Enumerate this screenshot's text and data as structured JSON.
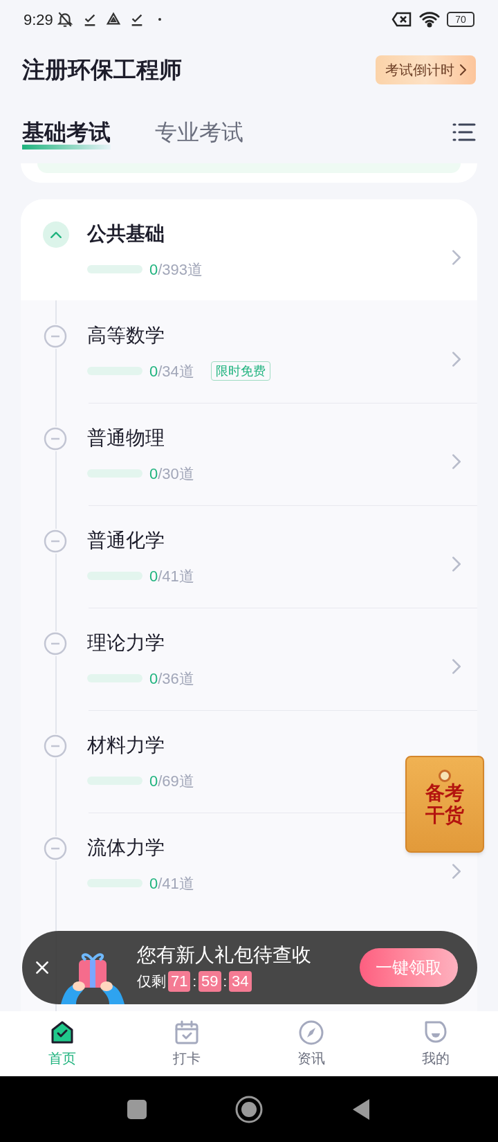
{
  "status_bar": {
    "time": "9:29",
    "battery": "70"
  },
  "header": {
    "title": "注册环保工程师",
    "countdown_button": "考试倒计时"
  },
  "tabs": [
    {
      "label": "基础考试",
      "selected": true
    },
    {
      "label": "专业考试",
      "selected": false
    }
  ],
  "section": {
    "title": "公共基础",
    "done": "0",
    "total": "/393道",
    "expanded": true,
    "level": 0
  },
  "subjects": [
    {
      "title": "高等数学",
      "done": "0",
      "total": "/34道",
      "tag": "限时免费",
      "level": 0
    },
    {
      "title": "普通物理",
      "done": "0",
      "total": "/30道",
      "level": 0
    },
    {
      "title": "普通化学",
      "done": "0",
      "total": "/41道",
      "level": 0
    },
    {
      "title": "理论力学",
      "done": "0",
      "total": "/36道",
      "level": 0
    },
    {
      "title": "材料力学",
      "done": "0",
      "total": "/69道",
      "level": 0
    },
    {
      "title": "流体力学",
      "done": "0",
      "total": "/41道",
      "level": 0
    }
  ],
  "float_badge": {
    "lines": [
      "备考",
      "干货"
    ]
  },
  "promo": {
    "title": "您有新人礼包待查收",
    "remaining_label": "仅剩",
    "countdown": [
      "71",
      "59",
      "34"
    ],
    "separator": ":",
    "button": "一键领取"
  },
  "bottom_nav": [
    {
      "label": "首页",
      "kind": "home",
      "selected": true
    },
    {
      "label": "打卡",
      "kind": "checkin",
      "selected": false
    },
    {
      "label": "资讯",
      "kind": "news",
      "selected": false
    },
    {
      "label": "我的",
      "kind": "profile",
      "selected": false
    }
  ]
}
